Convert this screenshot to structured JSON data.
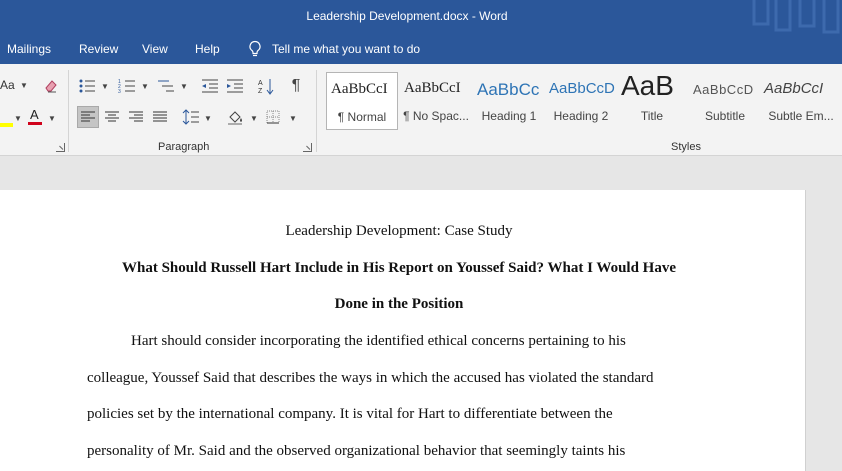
{
  "window": {
    "title": "Leadership Development.docx  -  Word"
  },
  "menu": {
    "tabs": [
      "Mailings",
      "Review",
      "View",
      "Help"
    ],
    "tell_me": "Tell me what you want to do"
  },
  "ribbon": {
    "font_partial": "Aa",
    "groups": {
      "paragraph": "Paragraph",
      "styles": "Styles"
    },
    "styles": [
      {
        "sample": "AaBbCcI",
        "name": "¶ Normal"
      },
      {
        "sample": "AaBbCcI",
        "name": "¶ No Spac..."
      },
      {
        "sample": "AaBbCc",
        "name": "Heading 1"
      },
      {
        "sample": "AaBbCcD",
        "name": "Heading 2"
      },
      {
        "sample": "AaB",
        "name": "Title"
      },
      {
        "sample": "AaBbCcD",
        "name": "Subtitle"
      },
      {
        "sample": "AaBbCcI",
        "name": "Subtle Em..."
      }
    ],
    "colors": {
      "highlight": "#ffff00",
      "font_color": "#d0021b",
      "heading_blue": "#2e74b5"
    }
  },
  "document": {
    "title": "Leadership Development: Case Study",
    "heading_line1": "What Should Russell Hart Include in His Report on Youssef Said? What I Would Have",
    "heading_line2": "Done in the Position",
    "lines": [
      "Hart should consider incorporating the identified ethical concerns pertaining to his",
      "colleague, Youssef Said that describes the ways in which the accused has violated the standard",
      "policies set by the international company. It is vital for Hart to differentiate between the",
      "personality of Mr. Said and the observed organizational behavior that seemingly taints his"
    ]
  }
}
